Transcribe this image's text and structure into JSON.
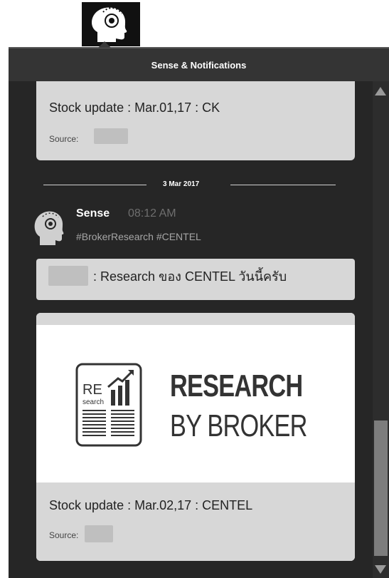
{
  "header": {
    "title": "Sense & Notifications",
    "app_icon": "brain-head-icon"
  },
  "messages": {
    "previous_card": {
      "title": "Stock update : Mar.01,17 : CK",
      "source_label": "Source:"
    },
    "date_separator": "3 Mar 2017",
    "post": {
      "sender": "Sense",
      "time": "08:12 AM",
      "tags": "#BrokerResearch #CENTEL",
      "text": ": Research ของ CENTEL วันนี้ครับ",
      "avatar_icon": "brain-head-icon"
    },
    "media_card": {
      "logo_text": "RE",
      "logo_sub": "search",
      "banner_line1": "RESEARCH",
      "banner_line2": "BY BROKER",
      "title": "Stock update : Mar.02,17 : CENTEL",
      "source_label": "Source:"
    }
  },
  "colors": {
    "panel_bg": "#262626",
    "header_bg": "#343434",
    "card_bg": "#d7d7d7",
    "scroll_thumb": "#7d7d7d"
  }
}
